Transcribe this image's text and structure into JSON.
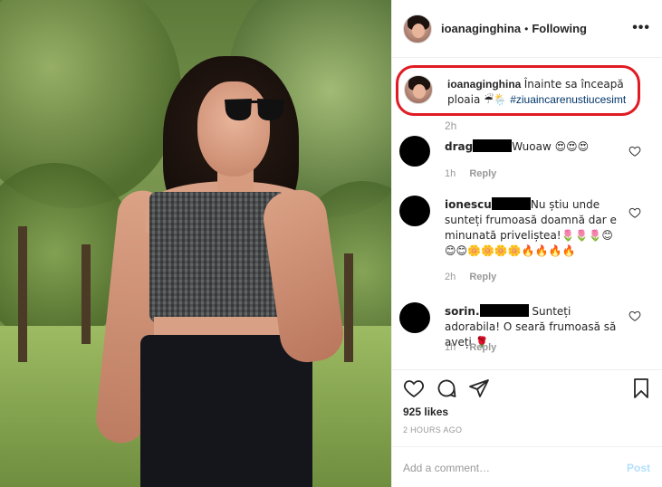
{
  "post": {
    "username": "ioanaginghina",
    "follow_status": "Following",
    "more": "•••",
    "caption_prefix": "Înainte sa înceapă ploaia ☔🌦️",
    "hashtag": "#ziuaincarenustiucesimt",
    "caption_time": "2h"
  },
  "comments": [
    {
      "name": "drag",
      "text": "Wuoaw 😍😍😍",
      "time": "1h",
      "reply": "Reply"
    },
    {
      "name": "ionescu",
      "text": "Nu știu unde sunteți frumoasă doamnă dar e minunată priveliștea!🌷🌷🌷😊😊😊🌼🌼🌼🌼🔥🔥🔥🔥",
      "time": "2h",
      "reply": "Reply"
    },
    {
      "name": "sorin.",
      "text": "Sunteți adorabila! O seară frumoasă să aveți 🌹",
      "time": "1h",
      "reply": "Reply"
    }
  ],
  "stats": {
    "likes": "925 likes",
    "ago": "2 HOURS AGO"
  },
  "composer": {
    "placeholder": "Add a comment…",
    "post_label": "Post"
  },
  "colors": {
    "highlight_border": "#e01b24",
    "hashtag": "#003569",
    "secondary_text": "#999999",
    "post_disabled": "#b2dffc"
  }
}
